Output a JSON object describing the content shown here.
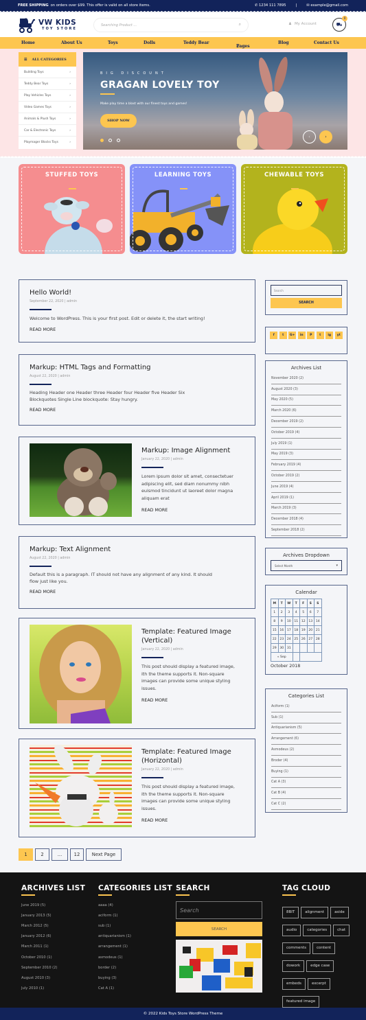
{
  "topbar": {
    "shipping_bold": "FREE SHIPPING",
    "shipping_text": "on orders over $99. This offer is valid on all store items.",
    "phone": "1234 111 7895",
    "separator": "|",
    "email": "example@gmail.com"
  },
  "header": {
    "brand_line1": "VW KIDS",
    "brand_line2": "TOY STORE",
    "search_placeholder": "Searching Product ...",
    "account_label": "My Account",
    "cart_count": "0"
  },
  "nav": {
    "items": [
      "Home",
      "About Us",
      "Toys",
      "Dolls",
      "Teddy Bear",
      "Pages",
      "Blog",
      "Contact Us"
    ]
  },
  "categories": {
    "title": "ALL CATEGORIES",
    "items": [
      "Building Toys",
      "Teddy Bear  Toys",
      "Play Vehicles  Toys",
      "Video Games  Toys",
      "Animals & Plush Toys",
      "Car & Electronic Toys",
      "Playmager Blocks Toys"
    ]
  },
  "slider": {
    "subtitle": "BIG DISCOUNT",
    "title": "GRAGAN LOVELY TOY",
    "description": "Make play time a blast with our finest toys and games!",
    "button": "SHOP NOW",
    "active_slide": 1,
    "total_slides": 3
  },
  "promos": [
    {
      "title": "STUFFED TOYS",
      "color": "#f58d8f"
    },
    {
      "title": "LEARNING TOYS",
      "color": "#8592f8"
    },
    {
      "title": "CHEWABLE TOYS",
      "color": "#b3b31d"
    }
  ],
  "posts": [
    {
      "title": "Hello World!",
      "meta": "September 22, 2020 | admin",
      "excerpt": "Welcome to WordPress. This is your first post. Edit or delete it, the start writing!",
      "more": "READ MORE"
    },
    {
      "title": "Markup: HTML Tags and Formatting",
      "meta": "August 22, 2020 | admin",
      "excerpt": "Heading Header one Header three Header four Header five Header Six Blockquotes Single Line blockquote: Stay hungry.",
      "more": "READ MORE"
    },
    {
      "title": "Markup: Image Alignment",
      "meta": "January 22, 2020 | admin",
      "excerpt": "Lorem ipsum dolor sit amet, consectetuer adipiscing elit, sed diam nonummy nibh euismod tincidunt ut laoreet dolor magna aliquam erat",
      "more": "READ MORE"
    },
    {
      "title": "Markup: Text Alignment",
      "meta": "August 22, 2020 | admin",
      "excerpt": "Default this is a paragraph. IT should not have any alignment of any kind. It should flow just like you.",
      "more": "READ MORE"
    },
    {
      "title": "Template: Featured Image (Vertical)",
      "meta": "January 22, 2020 | admin",
      "excerpt": "This post should display a featured image, ith the theme supports it. Non-square images can provide some unique styling issues.",
      "more": "READ MORE"
    },
    {
      "title": "Template: Featured Image (Horizontal)",
      "meta": "January 22, 2020 | admin",
      "excerpt": "This post should display a featured image, ith the theme supports it. Non-square images can provide some unique styling issues.",
      "more": "READ MORE"
    }
  ],
  "pagination": {
    "items": [
      "1",
      "2",
      "...",
      "12",
      "Next Page"
    ],
    "current": "1"
  },
  "sidebar": {
    "search_placeholder": "Search",
    "search_button": "SEARCH",
    "social": [
      "f",
      "t",
      "G+",
      "in",
      "P",
      "t",
      "ig",
      "yt"
    ],
    "archives_title": "Archives List",
    "archives": [
      "November 2020 (2)",
      "August 2020 (3)",
      "May 2020 (5)",
      "March 2020 (6)",
      "December 2019 (2)",
      "October 2019 (4)",
      "July 2019 (1)",
      "May 2019 (3)",
      "February 2019 (4)",
      "October 2019 (2)",
      "June 2019 (4)",
      "April 2019 (1)",
      "March 2019 (3)",
      "December 2018 (4)",
      "September 2018 (2)"
    ],
    "dropdown_title": "Archives Dropdown",
    "dropdown_value": "Select Month",
    "calendar_title": "Calendar",
    "calendar_days": [
      "M",
      "T",
      "W",
      "T",
      "F",
      "S",
      "S"
    ],
    "calendar_weeks": [
      [
        "1",
        "2",
        "3",
        "4",
        "5",
        "6",
        "7"
      ],
      [
        "8",
        "9",
        "10",
        "11",
        "12",
        "13",
        "14"
      ],
      [
        "15",
        "16",
        "17",
        "18",
        "19",
        "20",
        "21"
      ],
      [
        "22",
        "23",
        "24",
        "25",
        "26",
        "27",
        "28"
      ],
      [
        "29",
        "30",
        "31",
        "",
        "",
        "",
        ""
      ]
    ],
    "calendar_prev": "« Sep",
    "calendar_caption": "October 2018",
    "categories_title": "Categories List",
    "categories": [
      "Aciform (1)",
      "Sub (1)",
      "Antiquarianism (5)",
      "Arrangement (6)",
      "Asmodeus (2)",
      "Broder (4)",
      "Buying (1)",
      "Cat A (3)",
      "Cat B (4)",
      "Cat C (2)"
    ]
  },
  "footer": {
    "archives_title": "ARCHIVES LIST",
    "archives": [
      "June 2019 (5)",
      "January  2013 (5)",
      "March 2012 (5)",
      "January  2012 (6)",
      "March  2011 (1)",
      "October 2010 (1)",
      "September 2010 (2)",
      "August 2010 (3)",
      "July 2010 (1)"
    ],
    "categories_title": "CATEGORIES LIST",
    "categories": [
      "aaaa (4)",
      "aciform (1)",
      "sub (1)",
      "antiquarianism (1)",
      "arrangement (1)",
      "asmodeus (1)",
      "border (2)",
      "buying (3)",
      "Cat A (1)"
    ],
    "search_title": "SEARCH",
    "search_placeholder": "Search",
    "search_button": "SEARCH",
    "tags_title": "TAG CLOUD",
    "tags": [
      "8BIT",
      "alignment",
      "aside",
      "audio",
      "categories",
      "chat",
      "comments",
      "content",
      "dowork",
      "edge case",
      "embeds",
      "excerpt",
      "featured image"
    ],
    "copyright": "© 2022 Kids Toys Store WordPress Theme"
  }
}
